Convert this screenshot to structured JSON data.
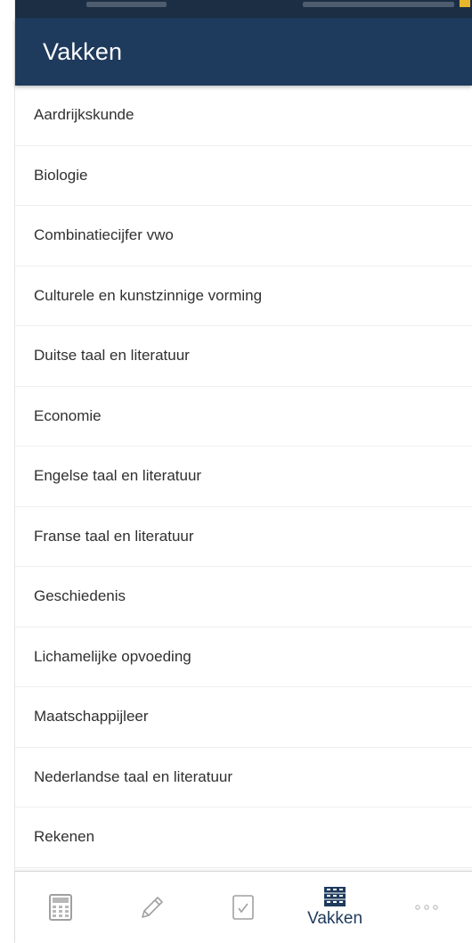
{
  "app_bar": {
    "title": "Vakken"
  },
  "subjects": [
    "Aardrijkskunde",
    "Biologie",
    "Combinatiecijfer vwo",
    "Culturele en kunstzinnige vorming",
    "Duitse taal en literatuur",
    "Economie",
    "Engelse taal en literatuur",
    "Franse taal en literatuur",
    "Geschiedenis",
    "Lichamelijke opvoeding",
    "Maatschappijleer",
    "Nederlandse taal en literatuur",
    "Rekenen"
  ],
  "bottom_nav": {
    "items": [
      {
        "icon": "calculator-icon"
      },
      {
        "icon": "pencil-icon"
      },
      {
        "icon": "checkbox-icon"
      },
      {
        "icon": "books-icon",
        "label": "Vakken",
        "active": true
      },
      {
        "icon": "more-icon"
      }
    ]
  },
  "colors": {
    "primary": "#1e3a5c",
    "status_bar": "#1b2e44"
  }
}
